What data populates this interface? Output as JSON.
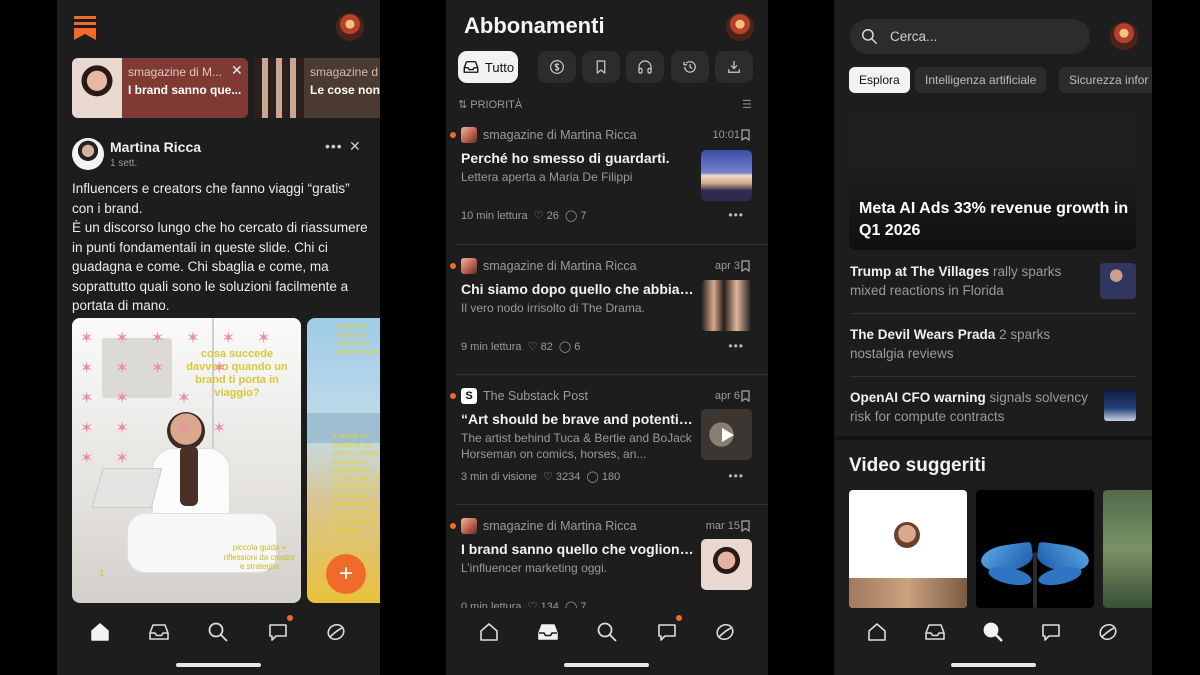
{
  "panel1": {
    "stories": [
      {
        "publisher": "smagazine di M...",
        "title": "I brand sanno que..."
      },
      {
        "publisher": "smagazine d",
        "title": "Le cose non"
      }
    ],
    "post": {
      "author": "Martina Ricca",
      "time": "1 sett.",
      "body": "Influencers e creators che fanno viaggi “gratis” con i brand.\nÈ un discorso lungo che ho cercato di riassumere in punti fondamentali in queste slide. Chi ci guadagna e come. Chi sbaglia e come, ma soprattutto quali sono le soluzioni facilmente a portata di mano.",
      "slide1_caption": "cosa succede davvero quando un brand ti porta in viaggio?",
      "slide1_footer": "piccola guida + riflessioni da creator e strategist",
      "slide1_page": "1",
      "slide2_top": "gli permet contenuti nessuna a partner lavoro.",
      "slide2_mid": "e anche un targeting ecc enorme: rispett campagna pubblicitaria tradizionale, se contenuti sono fatti impatto potenziale molto basso a fronte partecipazione altissimo"
    },
    "fab_label": "+"
  },
  "panel2": {
    "title": "Abbonamenti",
    "filter_all": "Tutto",
    "sort_label": "PRIORITÀ",
    "posts": [
      {
        "publisher": "smagazine di Martina Ricca",
        "date": "10:01",
        "title": "Perché ho smesso di guardarti.",
        "subtitle": "Lettera aperta a Maria De Filippi",
        "length": "10 min lettura",
        "likes": "26",
        "comments": "7",
        "unread": true
      },
      {
        "publisher": "smagazine di Martina Ricca",
        "date": "apr 3",
        "title": "Chi siamo dopo quello che abbiamo vissuto?",
        "subtitle": "Il vero nodo irrisolto di The Drama.",
        "length": "9 min lettura",
        "likes": "82",
        "comments": "6",
        "unread": true
      },
      {
        "publisher": "The Substack Post",
        "date": "apr 6",
        "title": "“Art should be brave and potentially offensive”",
        "subtitle": "The artist behind Tuca & Bertie and BoJack Horseman on comics, horses, an...",
        "length": "3 min di visione",
        "likes": "3234",
        "comments": "180",
        "unread": true
      },
      {
        "publisher": "smagazine di Martina Ricca",
        "date": "mar 15",
        "title": "I brand sanno quello che vogliono davvero?",
        "subtitle": "L’influencer marketing oggi.",
        "length": "0 min lettura",
        "likes": "134",
        "comments": "7",
        "unread": true
      }
    ]
  },
  "panel3": {
    "search_placeholder": "Cerca...",
    "chips": [
      "Esplora",
      "Intelligenza artificiale",
      "Sicurezza infor"
    ],
    "hero_title": "Meta AI Ads 33% revenue growth in Q1 2026",
    "news": [
      {
        "bold": "Trump at The Villages",
        "rest": " rally sparks mixed reactions in Florida"
      },
      {
        "bold": "The Devil Wears Prada",
        "rest": " 2 sparks nostalgia reviews"
      },
      {
        "bold": "OpenAI CFO warning",
        "rest": " signals solvency risk for compute contracts"
      }
    ],
    "videos_title": "Video suggeriti"
  },
  "colors": {
    "accent": "#f06b2b",
    "panel": "#1d1d1d",
    "card": "#2c2c2c"
  }
}
